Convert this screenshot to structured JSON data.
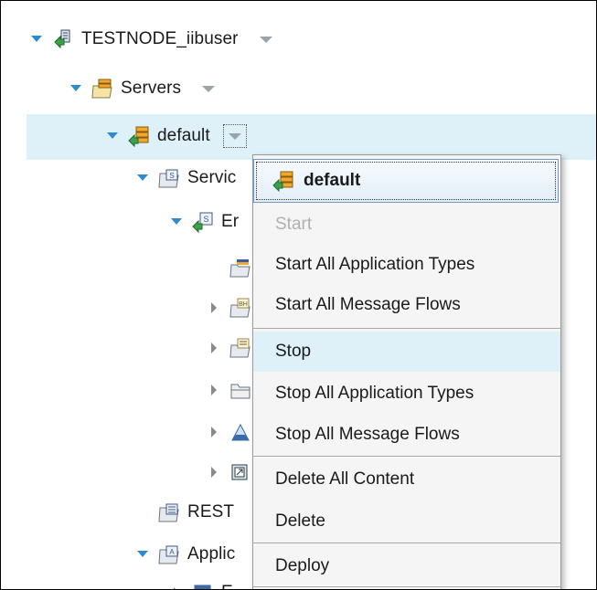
{
  "tree": {
    "node": {
      "label": "TESTNODE_iibuser",
      "icon": "integration-node-icon"
    },
    "servers": {
      "label": "Servers",
      "icon": "servers-folder-icon"
    },
    "server": {
      "label": "default",
      "icon": "integration-server-icon"
    },
    "children": [
      {
        "label": "Servic",
        "icon": "services-folder-icon",
        "expanded": true
      },
      {
        "label": "Er",
        "icon": "service-icon",
        "expanded": true
      },
      {
        "label": "",
        "icon": "interface-icon"
      },
      {
        "label": "",
        "icon": "operations-folder-icon"
      },
      {
        "label": "",
        "icon": "schema-folder-icon"
      },
      {
        "label": "",
        "icon": "folder-icon"
      },
      {
        "label": "",
        "icon": "subflow-icon"
      },
      {
        "label": "",
        "icon": "resources-icon"
      },
      {
        "label": "REST",
        "icon": "rest-apis-folder-icon"
      },
      {
        "label": "Applic",
        "icon": "applications-folder-icon",
        "expanded": true
      },
      {
        "label": "E",
        "icon": "application-icon"
      }
    ]
  },
  "context_menu": {
    "title": "default",
    "title_icon": "integration-server-icon",
    "items": [
      {
        "label": "Start",
        "disabled": true
      },
      {
        "label": "Start All Application Types"
      },
      {
        "label": "Start All Message Flows"
      },
      {
        "label": "Stop",
        "highlighted": true
      },
      {
        "label": "Stop All Application Types"
      },
      {
        "label": "Stop All Message Flows"
      },
      {
        "label": "Delete All Content"
      },
      {
        "label": "Delete"
      },
      {
        "label": "Deploy"
      }
    ]
  },
  "colors": {
    "selection": "#def0f8",
    "twisty": "#2e8bd0",
    "menu_background": "#f5f5f5",
    "disabled_text": "#b0b0b0"
  }
}
